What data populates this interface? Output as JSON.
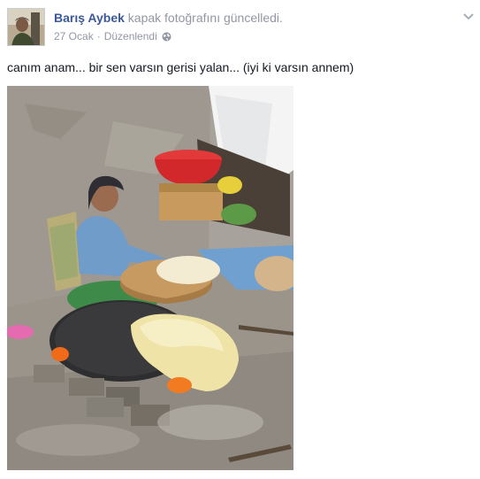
{
  "post": {
    "author_name": "Barış Aybek",
    "action_text": "kapak fotoğrafını güncelledi.",
    "date": "27 Ocak",
    "separator": "·",
    "edited_label": "Düzenlendi",
    "privacy_icon": "globe-icon",
    "options_icon": "chevron-down-icon",
    "text": "canım anam... bir sen varsın gerisi yalan... (iyi ki varsın annem)",
    "photo_icon": "cover-photo",
    "colors": {
      "link": "#3b5998",
      "meta": "#9197a3",
      "text": "#141823"
    }
  }
}
